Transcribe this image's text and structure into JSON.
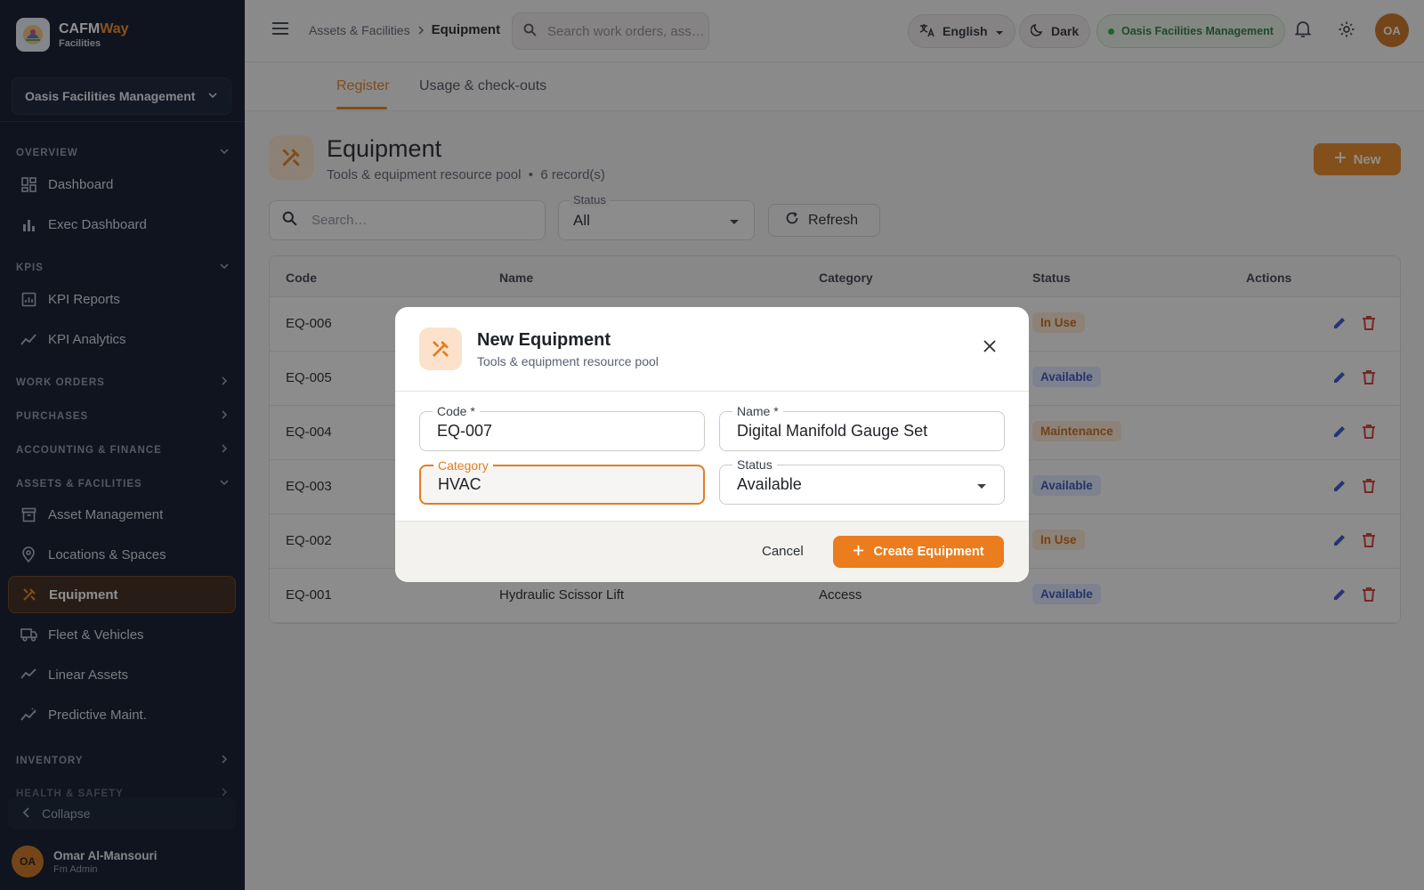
{
  "brand": {
    "name_prefix": "CAFM",
    "name_suffix": "Way",
    "subtitle": "Facilities"
  },
  "sidebar": {
    "org": "Oasis Facilities Management",
    "sections": {
      "overview": "OVERVIEW",
      "kpis": "KPIS",
      "work_orders": "WORK ORDERS",
      "purchases": "PURCHASES",
      "accounting": "ACCOUNTING & FINANCE",
      "assets": "ASSETS & FACILITIES",
      "inventory": "INVENTORY",
      "health": "HEALTH & SAFETY"
    },
    "items": {
      "dashboard": "Dashboard",
      "exec_dashboard": "Exec Dashboard",
      "kpi_reports": "KPI Reports",
      "kpi_analytics": "KPI Analytics",
      "asset_management": "Asset Management",
      "locations": "Locations & Spaces",
      "equipment": "Equipment",
      "fleet": "Fleet & Vehicles",
      "linear": "Linear Assets",
      "predictive": "Predictive Maint."
    },
    "collapse": "Collapse",
    "user": {
      "initials": "OA",
      "name": "Omar Al-Mansouri",
      "role": "Fm Admin"
    }
  },
  "topbar": {
    "breadcrumb_parent": "Assets & Facilities",
    "breadcrumb_current": "Equipment",
    "search_placeholder": "Search work orders, ass…",
    "language": "English",
    "theme": "Dark",
    "org": "Oasis Facilities Management",
    "avatar": "OA"
  },
  "tabs": {
    "register": "Register",
    "usage": "Usage & check-outs"
  },
  "page": {
    "title": "Equipment",
    "subtitle": "Tools & equipment resource pool",
    "records": "6 record(s)",
    "new_label": "New"
  },
  "filters": {
    "search_placeholder": "Search…",
    "status_label": "Status",
    "status_value": "All",
    "refresh": "Refresh"
  },
  "table": {
    "headers": {
      "code": "Code",
      "name": "Name",
      "category": "Category",
      "status": "Status",
      "actions": "Actions"
    },
    "rows": [
      {
        "code": "EQ-006",
        "name": "",
        "category": "",
        "status": "In Use"
      },
      {
        "code": "EQ-005",
        "name": "",
        "category": "",
        "status": "Available"
      },
      {
        "code": "EQ-004",
        "name": "",
        "category": "",
        "status": "Maintenance"
      },
      {
        "code": "EQ-003",
        "name": "",
        "category": "",
        "status": "Available"
      },
      {
        "code": "EQ-002",
        "name": "",
        "category": "",
        "status": "In Use"
      },
      {
        "code": "EQ-001",
        "name": "Hydraulic Scissor Lift",
        "category": "Access",
        "status": "Available"
      }
    ]
  },
  "modal": {
    "title": "New Equipment",
    "subtitle": "Tools & equipment resource pool",
    "code_label": "Code *",
    "code_value": "EQ-007",
    "name_label": "Name *",
    "name_value": "Digital Manifold Gauge Set",
    "category_label": "Category",
    "category_value": "HVAC",
    "status_label": "Status",
    "status_value": "Available",
    "cancel": "Cancel",
    "create": "Create Equipment"
  },
  "colors": {
    "accent": "#e8851f",
    "sidebar_bg": "#0c1526",
    "badge_inuse_bg": "#fbe6cf",
    "badge_inuse_fg": "#c86a14",
    "badge_available_bg": "#dfe6fb",
    "badge_available_fg": "#3351b8",
    "edit_icon": "#3454c4",
    "delete_icon": "#d23b2f"
  }
}
